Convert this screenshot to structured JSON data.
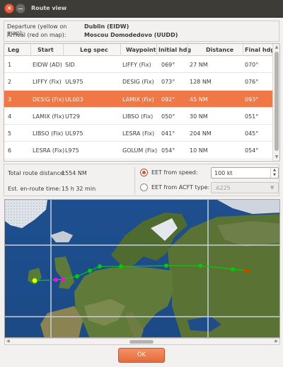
{
  "window": {
    "title": "Route view",
    "close_glyph": "×"
  },
  "route_info": {
    "departure_label": "Departure (yellow on map):",
    "departure_value": "Dublin (EIDW)",
    "arrival_label": "Arrival (red on map):",
    "arrival_value": "Moscou Domodedovo (UUDD)"
  },
  "table": {
    "columns": [
      "Leg",
      "Start",
      "Leg spec",
      "Waypoint",
      "Initial hdg",
      "Distance",
      "Final hdg"
    ],
    "rows": [
      [
        "1",
        "EIDW (AD)",
        "SID",
        "LIFFY (Fix)",
        "069°",
        "27 NM",
        "070°"
      ],
      [
        "2",
        "LIFFY (Fix)",
        "UL975",
        "DESIG (Fix)",
        "073°",
        "128 NM",
        "076°"
      ],
      [
        "3",
        "DESIG (Fix)",
        "UL603",
        "LAMIX (Fix)",
        "092°",
        "45 NM",
        "093°"
      ],
      [
        "4",
        "LAMIX (Fix)",
        "UT29",
        "LIBSO (Fix)",
        "050°",
        "30 NM",
        "051°"
      ],
      [
        "5",
        "LIBSO (Fix)",
        "UL975",
        "LESRA (Fix)",
        "041°",
        "204 NM",
        "045°"
      ],
      [
        "6",
        "LESRA (Fix)",
        "L975",
        "GOLUM (Fix)",
        "054°",
        "10 NM",
        "054°"
      ]
    ],
    "selected_row": 2
  },
  "stats": {
    "total_distance_label": "Total route distance:",
    "total_distance_value": "1554 NM",
    "eet_label": "Est. en-route time:",
    "eet_value": "15 h 32 min"
  },
  "eet_options": {
    "speed_label": "EET from speed:",
    "speed_value": "100 kt",
    "acft_label": "EET from ACFT type:",
    "acft_value": "A225",
    "selected": "speed"
  },
  "colors": {
    "accent": "#f07746",
    "route_line": "#00cc00",
    "departure_marker": "#ffff00",
    "arrival_marker": "#ff0000",
    "waypoint_marker": "#00cc00",
    "selected_leg_marker": "#ff00ff"
  },
  "icons": {
    "spin_up": "▲",
    "spin_down": "▼",
    "combo_arrow": "▼",
    "scroll_up": "▲",
    "scroll_down": "▼",
    "scroll_left": "◀",
    "scroll_right": "▶"
  },
  "buttons": {
    "ok": "OK"
  }
}
